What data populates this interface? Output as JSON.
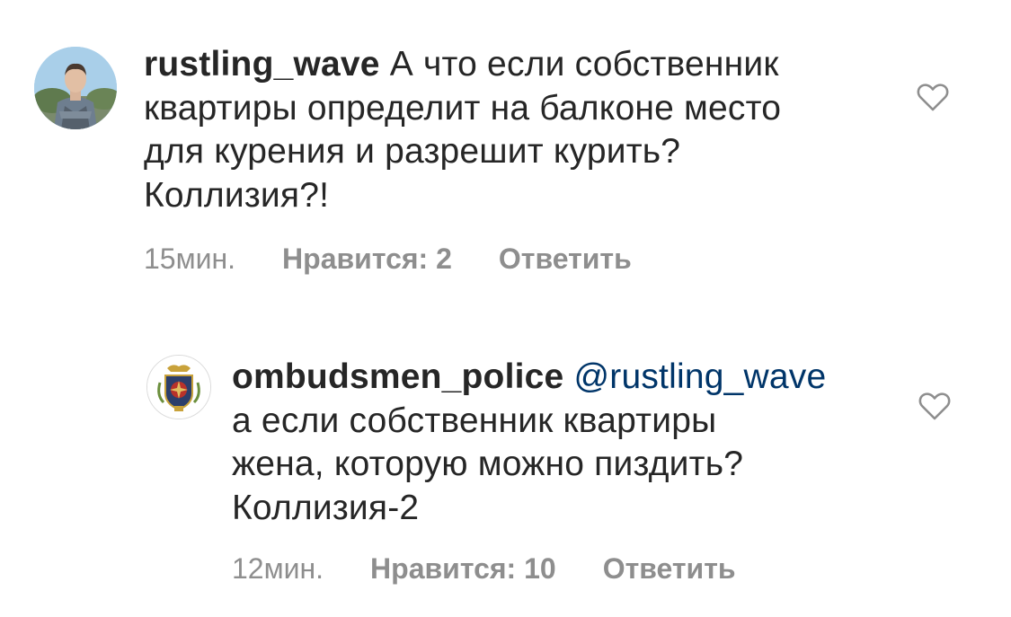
{
  "comments": [
    {
      "username": "rustling_wave",
      "mention": "",
      "text_lines": [
        " А что если собственник",
        "квартиры определит на балконе место",
        "для курения и разрешит курить?",
        "Коллизия?!"
      ],
      "time": "15мин.",
      "likes": "Нравится: 2",
      "reply": "Ответить",
      "avatar_icon": "user-photo-avatar",
      "like_icon": "heart-outline-icon"
    },
    {
      "username": "ombudsmen_police",
      "mention": "@rustling_wave",
      "text_lines": [
        "а если собственник квартиры",
        "жена, которую можно пиздить?",
        "Коллизия-2"
      ],
      "time": "12мин.",
      "likes": "Нравится: 10",
      "reply": "Ответить",
      "avatar_icon": "police-emblem-avatar",
      "like_icon": "heart-outline-icon"
    }
  ],
  "colors": {
    "text": "#262626",
    "meta": "#8e8e8e",
    "mention": "#003569",
    "background": "#ffffff"
  }
}
